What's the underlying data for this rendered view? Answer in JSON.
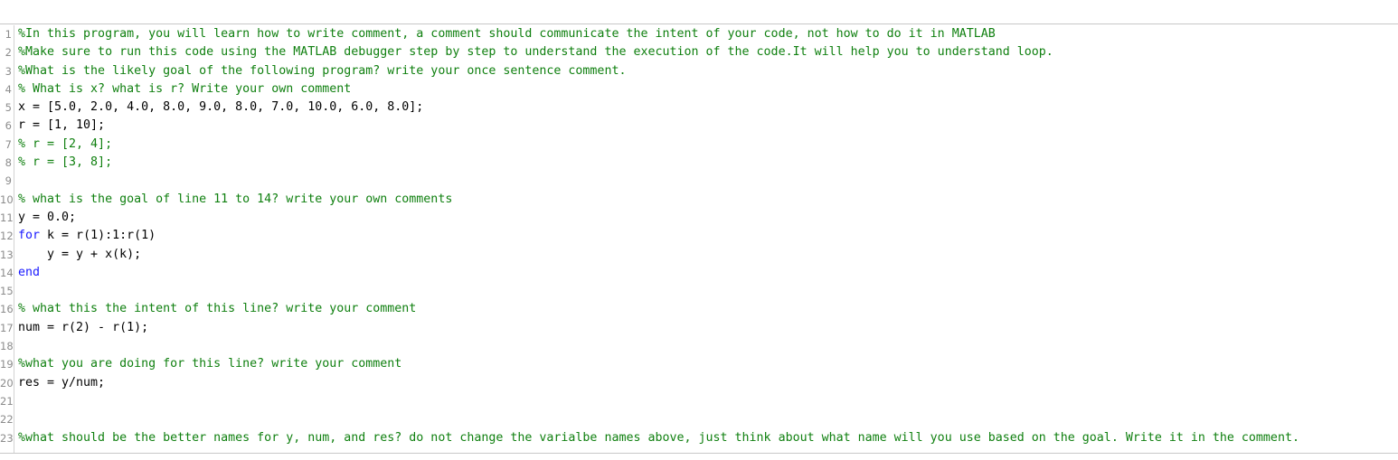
{
  "app": {
    "kind": "matlab-code-editor",
    "language": "MATLAB"
  },
  "colors": {
    "background": "#ffffff",
    "comment": "#108010",
    "keyword": "#1a1aff",
    "plain_code": "#000000",
    "line_number": "#8c8c8c",
    "gutter_rule": "#d2d2d2",
    "border": "#c8c8c8"
  },
  "editor": {
    "first_line_number": 1,
    "last_line_number": 23,
    "total_lines": 23,
    "lines": [
      {
        "number": "1",
        "indent": 0,
        "tokens": [
          {
            "type": "comment",
            "text": "%In this program, you will learn how to write comment, a comment should communicate the intent of your code, not how to do it in MATLAB"
          }
        ]
      },
      {
        "number": "2",
        "indent": 0,
        "tokens": [
          {
            "type": "comment",
            "text": "%Make sure to run this code using the MATLAB debugger step by step to understand the execution of the code.It will help you to understand loop."
          }
        ]
      },
      {
        "number": "3",
        "indent": 0,
        "tokens": [
          {
            "type": "comment",
            "text": "%What is the likely goal of the following program? write your once sentence comment."
          }
        ]
      },
      {
        "number": "4",
        "indent": 0,
        "tokens": [
          {
            "type": "comment",
            "text": "% What is x? what is r? Write your own comment"
          }
        ]
      },
      {
        "number": "5",
        "indent": 0,
        "tokens": [
          {
            "type": "plain",
            "text": "x = [5.0, 2.0, 4.0, 8.0, 9.0, 8.0, 7.0, 10.0, 6.0, 8.0];"
          }
        ]
      },
      {
        "number": "6",
        "indent": 0,
        "tokens": [
          {
            "type": "plain",
            "text": "r = [1, 10];"
          }
        ]
      },
      {
        "number": "7",
        "indent": 0,
        "tokens": [
          {
            "type": "comment",
            "text": "% r = [2, 4];"
          }
        ]
      },
      {
        "number": "8",
        "indent": 0,
        "tokens": [
          {
            "type": "comment",
            "text": "% r = [3, 8];"
          }
        ]
      },
      {
        "number": "9",
        "indent": 0,
        "tokens": []
      },
      {
        "number": "10",
        "indent": 0,
        "tokens": [
          {
            "type": "comment",
            "text": "% what is the goal of line 11 to 14? write your own comments"
          }
        ]
      },
      {
        "number": "11",
        "indent": 0,
        "tokens": [
          {
            "type": "plain",
            "text": "y = 0.0;"
          }
        ]
      },
      {
        "number": "12",
        "indent": 0,
        "tokens": [
          {
            "type": "keyword",
            "text": "for"
          },
          {
            "type": "plain",
            "text": " k = r(1):1:r(1)"
          }
        ]
      },
      {
        "number": "13",
        "indent": 0,
        "tokens": [
          {
            "type": "plain",
            "text": "    y = y + x(k);"
          }
        ]
      },
      {
        "number": "14",
        "indent": 0,
        "tokens": [
          {
            "type": "keyword",
            "text": "end"
          }
        ]
      },
      {
        "number": "15",
        "indent": 0,
        "tokens": []
      },
      {
        "number": "16",
        "indent": 0,
        "tokens": [
          {
            "type": "comment",
            "text": "% what this the intent of this line? write your comment"
          }
        ]
      },
      {
        "number": "17",
        "indent": 0,
        "tokens": [
          {
            "type": "plain",
            "text": "num = r(2) - r(1);"
          }
        ]
      },
      {
        "number": "18",
        "indent": 0,
        "tokens": []
      },
      {
        "number": "19",
        "indent": 0,
        "tokens": [
          {
            "type": "comment",
            "text": "%what you are doing for this line? write your comment"
          }
        ]
      },
      {
        "number": "20",
        "indent": 0,
        "tokens": [
          {
            "type": "plain",
            "text": "res = y/num;"
          }
        ]
      },
      {
        "number": "21",
        "indent": 0,
        "tokens": []
      },
      {
        "number": "22",
        "indent": 0,
        "tokens": []
      },
      {
        "number": "23",
        "indent": 0,
        "tokens": [
          {
            "type": "comment",
            "text": "%what should be the better names for y, num, and res? do not change the varialbe names above, just think about what name will you use based on the goal. Write it in the comment."
          }
        ]
      }
    ]
  }
}
